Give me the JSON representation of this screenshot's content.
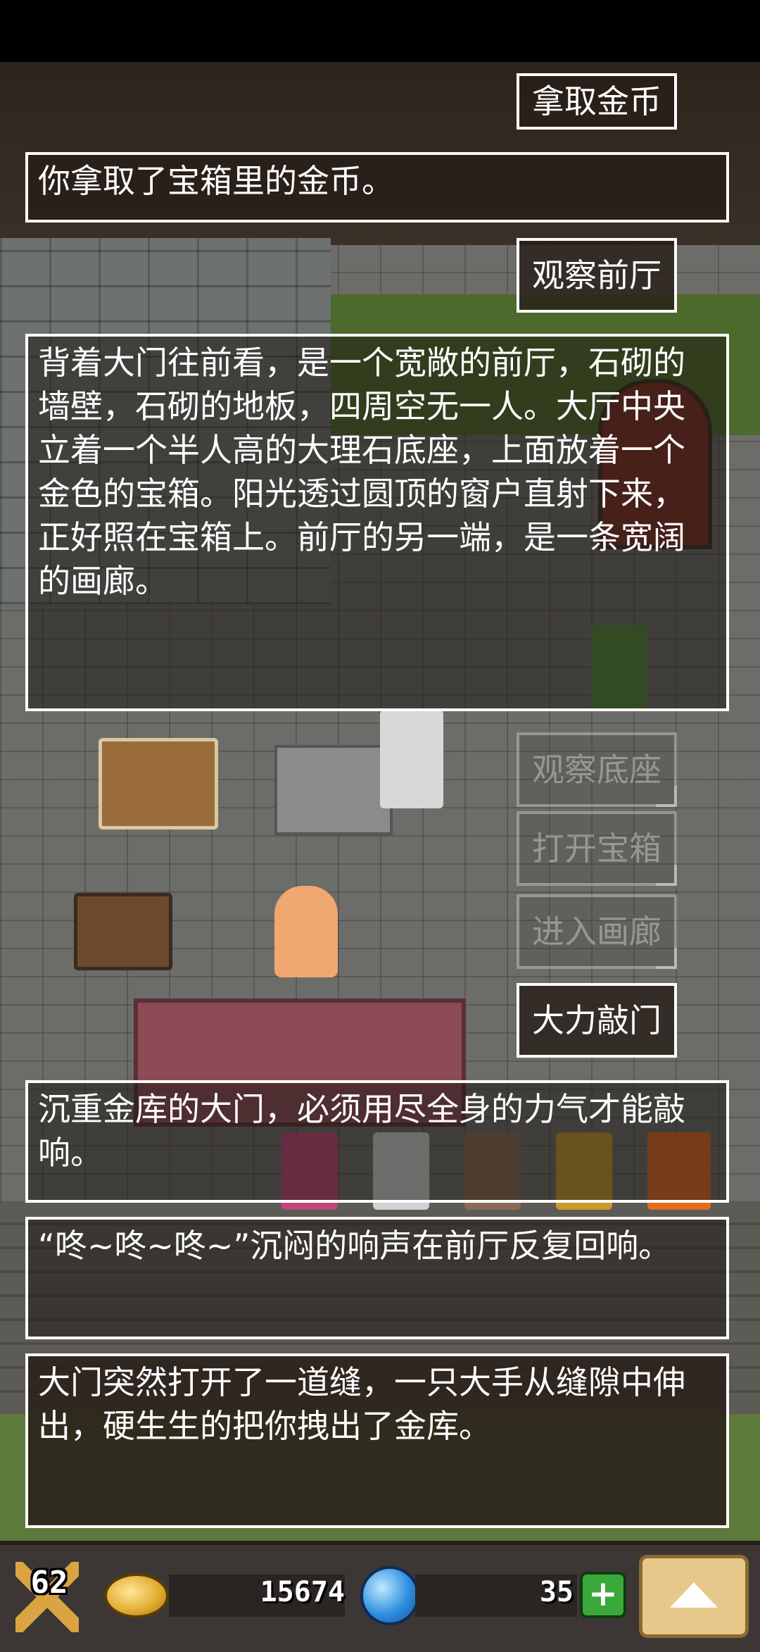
{
  "choices": {
    "take_coins": "拿取金币",
    "observe_hall": "观察前厅",
    "observe_pedestal": "观察底座",
    "open_chest": "打开宝箱",
    "enter_gallery": "进入画廊",
    "knock_door": "大力敲门"
  },
  "messages": {
    "took_coins": "你拿取了宝箱里的金币。",
    "hall_description": "背着大门往前看，是一个宽敞的前厅，石砌的墙壁，石砌的地板，四周空无一人。大厅中央立着一个半人高的大理石底座，上面放着一个金色的宝箱。阳光透过圆顶的窗户直射下来，正好照在宝箱上。前厅的另一端，是一条宽阔的画廊。",
    "heavy_door": "沉重金库的大门，必须用尽全身的力气才能敲响。",
    "echo": "“咚~咚~咚~”沉闷的响声在前厅反复回响。",
    "pulled_out": "大门突然打开了一道缝，一只大手从缝隙中伸出，硬生生的把你拽出了金库。"
  },
  "status": {
    "level": "62",
    "coins": "15674",
    "gems": "35"
  },
  "icons": {
    "level": "crossed-swords-icon",
    "coin": "coin-icon",
    "gem": "gem-icon",
    "add": "plus-icon",
    "menu": "up-arrow-icon"
  }
}
